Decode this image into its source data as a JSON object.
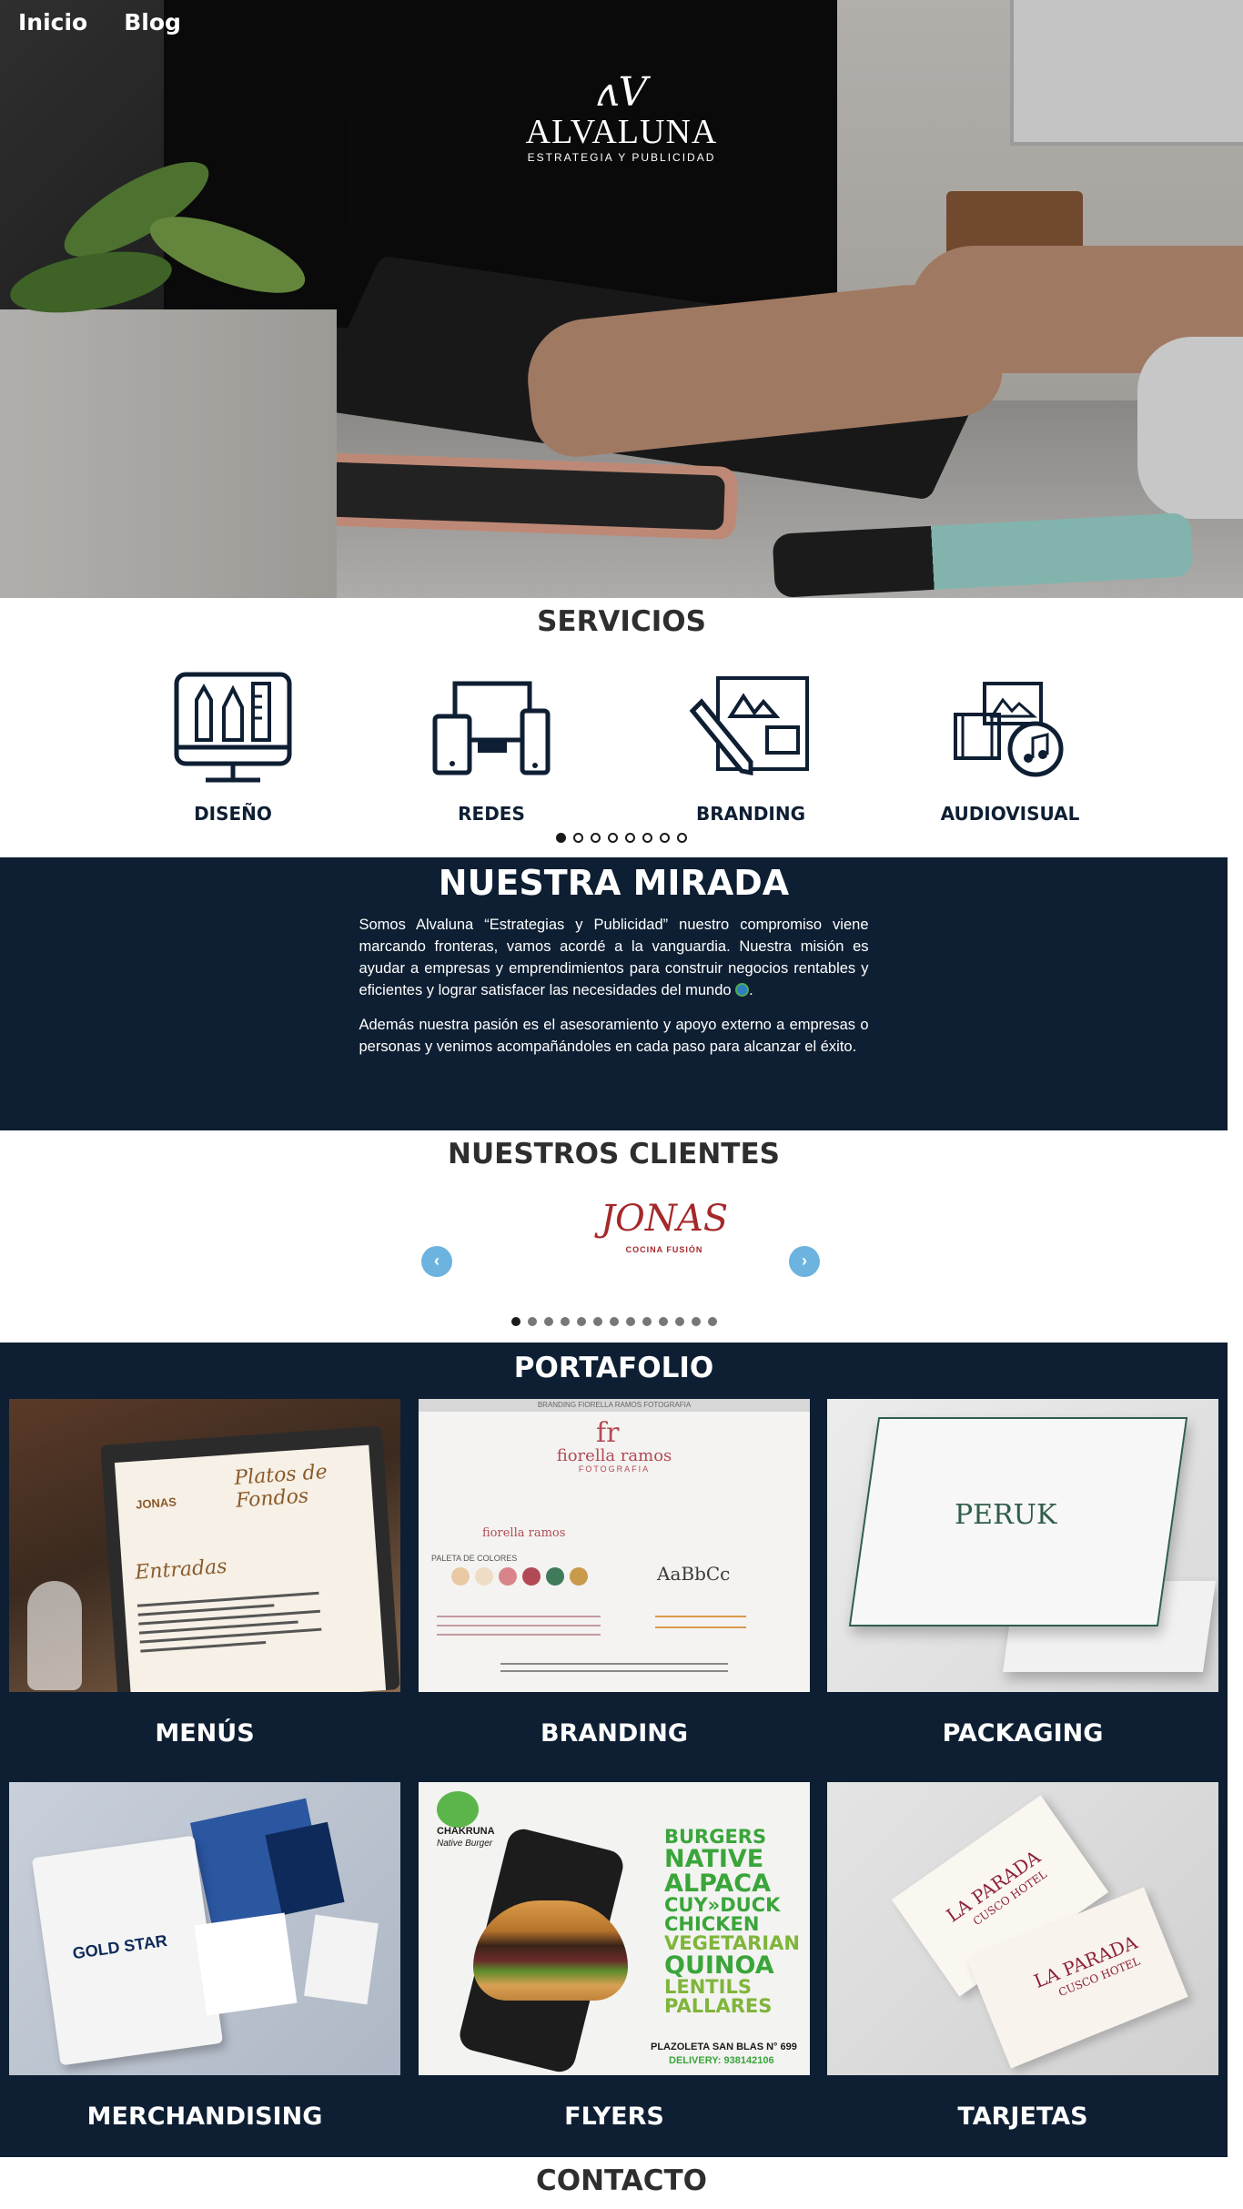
{
  "nav": {
    "items": [
      "Inicio",
      "Blog"
    ]
  },
  "logo": {
    "mark": "ʌV",
    "name": "ALVALUNA",
    "tagline": "ESTRATEGIA Y PUBLICIDAD"
  },
  "servicios": {
    "title": "SERVICIOS",
    "items": [
      {
        "label": "DISEÑO",
        "icon": "design-tools-monitor-icon"
      },
      {
        "label": "REDES",
        "icon": "devices-icon"
      },
      {
        "label": "BRANDING",
        "icon": "branding-pencil-icon"
      },
      {
        "label": "AUDIOVISUAL",
        "icon": "film-music-icon"
      }
    ],
    "dots": 8,
    "active_dot": 0
  },
  "mirada": {
    "title": "NUESTRA MIRADA",
    "p1": "Somos Alvaluna “Estrategias y Publicidad” nuestro compromiso viene marcando fronteras, vamos acordé a la vanguardia. Nuestra misión es ayudar a empresas y emprendimientos para construir negocios rentables y eficientes y lograr satisfacer las necesidades del mundo",
    "p1_end": ".",
    "p2": "Además nuestra pasión es el asesoramiento y apoyo externo a empresas o personas y venimos acompañándoles en cada paso para alcanzar el éxito."
  },
  "clientes": {
    "title": "NUESTROS CLIENTES",
    "client_logo": {
      "name": "JONAS",
      "sub": "COCINA FUSIÓN"
    },
    "prev": "‹",
    "next": "›",
    "dots": 13,
    "active_dot": 0
  },
  "portafolio": {
    "title": "PORTAFOLIO",
    "items": [
      {
        "label": "MENÚS"
      },
      {
        "label": "BRANDING"
      },
      {
        "label": "PACKAGING"
      },
      {
        "label": "MERCHANDISING"
      },
      {
        "label": "FLYERS"
      },
      {
        "label": "TARJETAS"
      }
    ],
    "thumb_text": {
      "menus_title": "Platos de Fondos",
      "menus_section": "Entradas",
      "menus_brand": "JONAS",
      "brand_header": "BRANDING FIORELLA RAMOS FOTOGRAFIA",
      "brand_name": "fiorella ramos",
      "brand_sub": "FOTOGRAFIA",
      "brand_palette": "PALETA DE COLORES",
      "brand_fonts": "AaBbCc",
      "packaging_brand": "PERUK",
      "merch_brand": "GOLD STAR",
      "flyer_brand": "CHAKRUNA",
      "flyer_sub": "Native Burger",
      "flyer_words": [
        "BURGERS",
        "NATIVE",
        "ALPACA",
        "CUY»DUCK",
        "CHICKEN",
        "VEGETARIAN",
        "QUINOA",
        "LENTILS",
        "PALLARES"
      ],
      "flyer_address": "PLAZOLETA SAN BLAS N° 699",
      "flyer_delivery": "DELIVERY: 938142106",
      "card_brand": "LA PARADA",
      "card_sub": "CUSCO HOTEL"
    }
  },
  "contacto": {
    "title": "CONTACTO"
  },
  "colors": {
    "navy": "#0e1f33",
    "accent_blue": "#6cb3df",
    "jonas_red": "#a5282a",
    "flyer_green": "#3aa53a"
  }
}
